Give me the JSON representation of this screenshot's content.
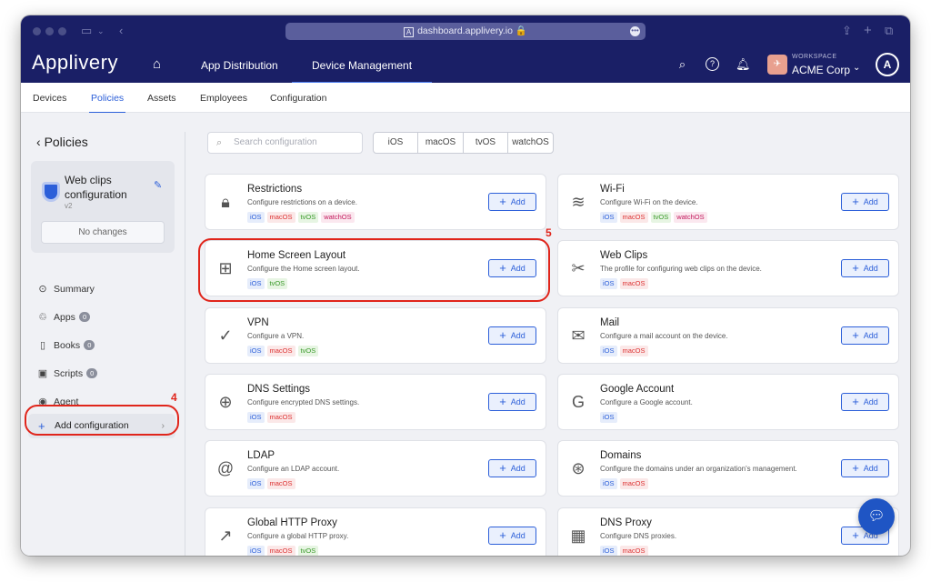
{
  "browser": {
    "url": "dashboard.applivery.io"
  },
  "header": {
    "logo": "Applivery",
    "tabs": [
      {
        "label": "App Distribution"
      },
      {
        "label": "Device Management"
      }
    ],
    "workspace_label": "WORKSPACE",
    "workspace_name": "ACME Corp",
    "avatar": "A"
  },
  "subnav": [
    {
      "label": "Devices"
    },
    {
      "label": "Policies"
    },
    {
      "label": "Assets"
    },
    {
      "label": "Employees"
    },
    {
      "label": "Configuration"
    }
  ],
  "sidebar": {
    "back_label": "Policies",
    "policy_title": "Web clips configuration",
    "policy_version": "v2",
    "status": "No changes",
    "items": [
      {
        "label": "Summary",
        "icon": "summary-icon"
      },
      {
        "label": "Apps",
        "count": "0",
        "icon": "apps-icon"
      },
      {
        "label": "Books",
        "count": "0",
        "icon": "books-icon"
      },
      {
        "label": "Scripts",
        "count": "0",
        "icon": "scripts-icon"
      },
      {
        "label": "Agent",
        "icon": "agent-icon"
      }
    ],
    "add_config": "Add configuration"
  },
  "annotations": {
    "step4": "4",
    "step5": "5"
  },
  "toolbar": {
    "search_placeholder": "Search configuration",
    "platforms": [
      "iOS",
      "macOS",
      "tvOS",
      "watchOS"
    ]
  },
  "add_label": "Add",
  "configs": [
    {
      "title": "Restrictions",
      "desc": "Configure restrictions on a device.",
      "tags": [
        "iOS",
        "macOS",
        "tvOS",
        "watchOS"
      ],
      "icon": "lock-icon"
    },
    {
      "title": "Wi-Fi",
      "desc": "Configure Wi-Fi on the device.",
      "tags": [
        "iOS",
        "macOS",
        "tvOS",
        "watchOS"
      ],
      "icon": "wifi-icon"
    },
    {
      "title": "Home Screen Layout",
      "desc": "Configure the Home screen layout.",
      "tags": [
        "iOS",
        "tvOS"
      ],
      "icon": "grid-icon"
    },
    {
      "title": "Web Clips",
      "desc": "The profile for configuring web clips on the device.",
      "tags": [
        "iOS",
        "macOS"
      ],
      "icon": "scissors-icon"
    },
    {
      "title": "VPN",
      "desc": "Configure a VPN.",
      "tags": [
        "iOS",
        "macOS",
        "tvOS"
      ],
      "icon": "shield-check-icon"
    },
    {
      "title": "Mail",
      "desc": "Configure a mail account on the device.",
      "tags": [
        "iOS",
        "macOS"
      ],
      "icon": "mail-icon"
    },
    {
      "title": "DNS Settings",
      "desc": "Configure encrypted DNS settings.",
      "tags": [
        "iOS",
        "macOS"
      ],
      "icon": "globe-icon"
    },
    {
      "title": "Google Account",
      "desc": "Configure a Google account.",
      "tags": [
        "iOS"
      ],
      "icon": "google-icon"
    },
    {
      "title": "LDAP",
      "desc": "Configure an LDAP account.",
      "tags": [
        "iOS",
        "macOS"
      ],
      "icon": "at-icon"
    },
    {
      "title": "Domains",
      "desc": "Configure the domains under an organization's management.",
      "tags": [
        "iOS",
        "macOS"
      ],
      "icon": "globe-domains-icon"
    },
    {
      "title": "Global HTTP Proxy",
      "desc": "Configure a global HTTP proxy.",
      "tags": [
        "iOS",
        "macOS",
        "tvOS"
      ],
      "icon": "proxy-icon"
    },
    {
      "title": "DNS Proxy",
      "desc": "Configure DNS proxies.",
      "tags": [
        "iOS",
        "macOS"
      ],
      "icon": "table-icon"
    }
  ]
}
